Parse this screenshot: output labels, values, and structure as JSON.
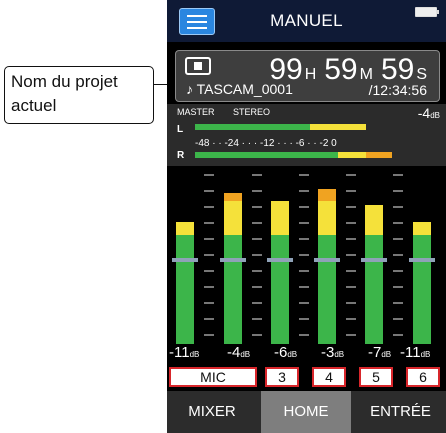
{
  "callout": {
    "text": "Nom du projet actuel"
  },
  "header": {
    "title": "MANUEL"
  },
  "transport": {
    "time": {
      "h": "99",
      "h_unit": "H",
      "m": "59",
      "m_unit": "M",
      "s": "59",
      "s_unit": "S"
    },
    "project_name": "♪ TASCAM_0001",
    "remaining": "/12:34:56"
  },
  "master": {
    "label_master": "MASTER",
    "label_stereo": "STEREO",
    "level": "-4",
    "level_unit": "dB",
    "left_label": "L",
    "right_label": "R",
    "scale": [
      "-48",
      "-24",
      "-12",
      "-6",
      "-2",
      "0"
    ]
  },
  "channels": [
    {
      "level": "-11",
      "unit": "dB",
      "button": "MIC"
    },
    {
      "level": "-4",
      "unit": "dB",
      "button": "3"
    },
    {
      "level": "-6",
      "unit": "dB",
      "button": "4"
    },
    {
      "level": "-3",
      "unit": "dB",
      "button": "5"
    },
    {
      "level": "-7",
      "unit": "dB",
      "button": "6"
    },
    {
      "level": "-11",
      "unit": "dB"
    }
  ],
  "tabs": [
    {
      "label": "MIXER",
      "active": false
    },
    {
      "label": "HOME",
      "active": true
    },
    {
      "label": "ENTRÉE",
      "active": false
    }
  ],
  "colors": {
    "green": "#3cb54a",
    "yellow": "#f5e13a",
    "orange": "#f0a321",
    "accent": "#2a86e0",
    "channel_border": "#d8262b"
  }
}
